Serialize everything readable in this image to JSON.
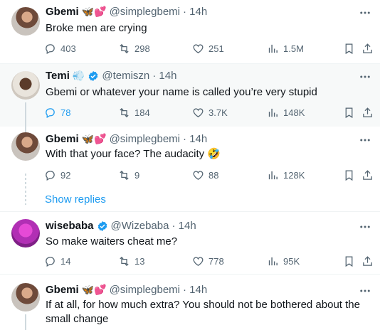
{
  "tweets": [
    {
      "name": "Gbemi",
      "emoji": "🦋💕",
      "handle": "@simplegbemi",
      "time": "· 14h",
      "text": "Broke men are crying",
      "replies": "403",
      "retweets": "298",
      "likes": "251",
      "views": "1.5M",
      "verified": false
    },
    {
      "name": "Temi",
      "emoji": "💨",
      "handle": "@temiszn",
      "time": "· 14h",
      "text": "Gbemi or whatever your name is called you’re very stupid",
      "replies": "78",
      "retweets": "184",
      "likes": "3.7K",
      "views": "148K",
      "verified": true
    },
    {
      "name": "Gbemi",
      "emoji": "🦋💕",
      "handle": "@simplegbemi",
      "time": "· 14h",
      "text": "With that your face? The audacity 🤣",
      "replies": "92",
      "retweets": "9",
      "likes": "88",
      "views": "128K",
      "verified": false
    },
    {
      "name": "wisebaba",
      "emoji": "",
      "handle": "@Wizebaba",
      "time": "· 14h",
      "text": "So make waiters cheat me?",
      "replies": "14",
      "retweets": "13",
      "likes": "778",
      "views": "95K",
      "verified": true
    },
    {
      "name": "Gbemi",
      "emoji": "🦋💕",
      "handle": "@simplegbemi",
      "time": "· 14h",
      "text": "If at all, for how much extra? You should not be bothered about the small change",
      "verified": false
    }
  ],
  "show_replies": "Show replies",
  "colors": {
    "accent": "#1d9bf0",
    "muted": "#536471",
    "text": "#0f1419",
    "highlight_bg": "#f7f9f9"
  }
}
